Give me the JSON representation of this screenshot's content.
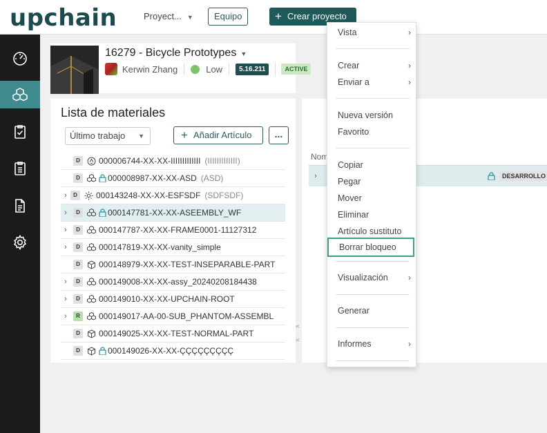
{
  "header": {
    "logo": "upchain",
    "project_selector": "Proyect...",
    "team_button": "Equipo",
    "create_project_button": "Crear proyecto"
  },
  "nav": {
    "items": [
      "dashboard-icon",
      "cubes-icon",
      "clipboard-check-icon",
      "clipboard-list-icon",
      "document-icon",
      "settings-icon"
    ],
    "active": "cubes-icon"
  },
  "project": {
    "title": "16279 - Bicycle Prototypes",
    "owner": "Kerwin Zhang",
    "priority": "Low",
    "version": "5.16.211",
    "status": "ACTIVE"
  },
  "bom": {
    "title": "Lista de materiales",
    "filter": "Último trabajo",
    "add_button": "Añadir Artículo",
    "more_button": "...",
    "rows": [
      {
        "type": "D",
        "label": "000006744-XX-XX-IIIIIIIIIIIII",
        "alt": "(IIIIIIIIIIIII)"
      },
      {
        "type": "D",
        "label": "000008987-XX-XX-ASD",
        "alt": "(ASD)"
      },
      {
        "type": "D",
        "label": "000143248-XX-XX-ESFSDF",
        "alt": "(SDFSDF)"
      },
      {
        "type": "D",
        "label": "000147781-XX-XX-ASEEMBLY_WF",
        "alt": ""
      },
      {
        "type": "D",
        "label": "000147787-XX-XX-FRAME0001-11127312",
        "alt": ""
      },
      {
        "type": "D",
        "label": "000147819-XX-XX-vanity_simple",
        "alt": ""
      },
      {
        "type": "D",
        "label": "000148979-XX-XX-TEST-INSEPARABLE-PART",
        "alt": ""
      },
      {
        "type": "D",
        "label": "000149008-XX-XX-assy_20240208184438",
        "alt": ""
      },
      {
        "type": "D",
        "label": "000149010-XX-XX-UPCHAIN-ROOT",
        "alt": ""
      },
      {
        "type": "R",
        "label": "000149017-AA-00-SUB_PHANTOM-ASSEMBL",
        "alt": ""
      },
      {
        "type": "D",
        "label": "000149025-XX-XX-TEST-NORMAL-PART",
        "alt": ""
      },
      {
        "type": "D",
        "label": "000149026-XX-XX-ÇÇÇÇÇÇÇÇÇ",
        "alt": ""
      }
    ]
  },
  "right_panel": {
    "column_header": "Nom",
    "row_badge": "DESARROLLO"
  },
  "context_menu": {
    "items": {
      "vista": "Vista",
      "crear": "Crear",
      "enviar": "Enviar a",
      "nueva_version": "Nueva versión",
      "favorito": "Favorito",
      "copiar": "Copiar",
      "pegar": "Pegar",
      "mover": "Mover",
      "eliminar": "Eliminar",
      "sustituto": "Artículo sustituto",
      "borrar_bloqueo": "Borrar bloqueo",
      "visualizacion": "Visualización",
      "generar": "Generar",
      "informes": "Informes"
    },
    "highlighted": "Borrar bloqueo"
  },
  "colors": {
    "brand": "#1d4a4e",
    "primary_button": "#1e5a5a",
    "nav_active": "#3e8a8f",
    "highlight_border": "#3aa17e"
  }
}
